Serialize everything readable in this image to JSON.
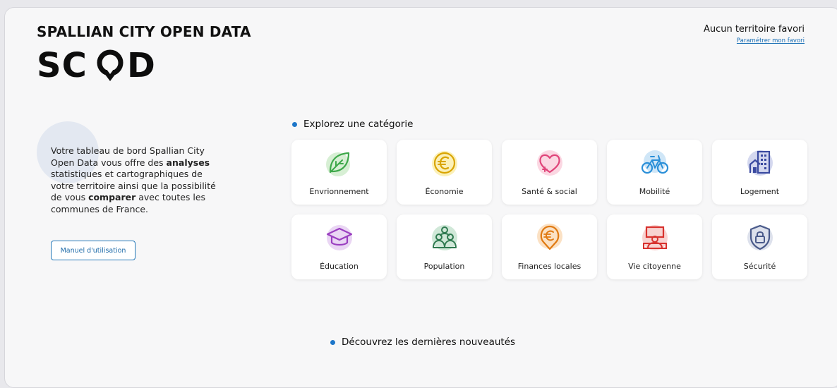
{
  "header": {
    "brand_title": "SPALLIAN CITY OPEN DATA",
    "logo_text": "SCOD",
    "favorite_title": "Aucun territoire favori",
    "favorite_link": "Paramétrer mon favori"
  },
  "intro": {
    "text_parts": [
      "Votre tableau de bord Spallian City Open Data vous offre des ",
      "analyses",
      " statistiques et cartographiques de votre territoire ainsi que la possibilité de vous ",
      "comparer",
      " avec toutes les communes de France."
    ],
    "manual_button": "Manuel d'utilisation"
  },
  "categories": {
    "title": "Explorez une catégorie",
    "items": [
      {
        "label": "Envrionnement",
        "icon": "leaf-icon",
        "color": "#3ea84a",
        "bg": "#d7efd4"
      },
      {
        "label": "Économie",
        "icon": "euro-coin-icon",
        "color": "#d9a400",
        "bg": "#fbf0b8"
      },
      {
        "label": "Santé & social",
        "icon": "heart-icon",
        "color": "#e0457a",
        "bg": "#fbd7e2"
      },
      {
        "label": "Mobilité",
        "icon": "bicycle-icon",
        "color": "#2a8fd8",
        "bg": "#cfe6f7"
      },
      {
        "label": "Logement",
        "icon": "building-icon",
        "color": "#3a4aa0",
        "bg": "#d4d8ef"
      },
      {
        "label": "Éducation",
        "icon": "graduation-cap-icon",
        "color": "#9a3fc0",
        "bg": "#ead6f4"
      },
      {
        "label": "Population",
        "icon": "people-icon",
        "color": "#2f7a50",
        "bg": "#d0e8d8"
      },
      {
        "label": "Finances locales",
        "icon": "euro-pin-icon",
        "color": "#e07a12",
        "bg": "#fbe1c4"
      },
      {
        "label": "Vie citoyenne",
        "icon": "speaker-podium-icon",
        "color": "#d8322e",
        "bg": "#f8d3d1"
      },
      {
        "label": "Sécurité",
        "icon": "shield-lock-icon",
        "color": "#4a5a8a",
        "bg": "#dde1ec"
      }
    ]
  },
  "news": {
    "title": "Découvrez les dernières nouveautés"
  }
}
